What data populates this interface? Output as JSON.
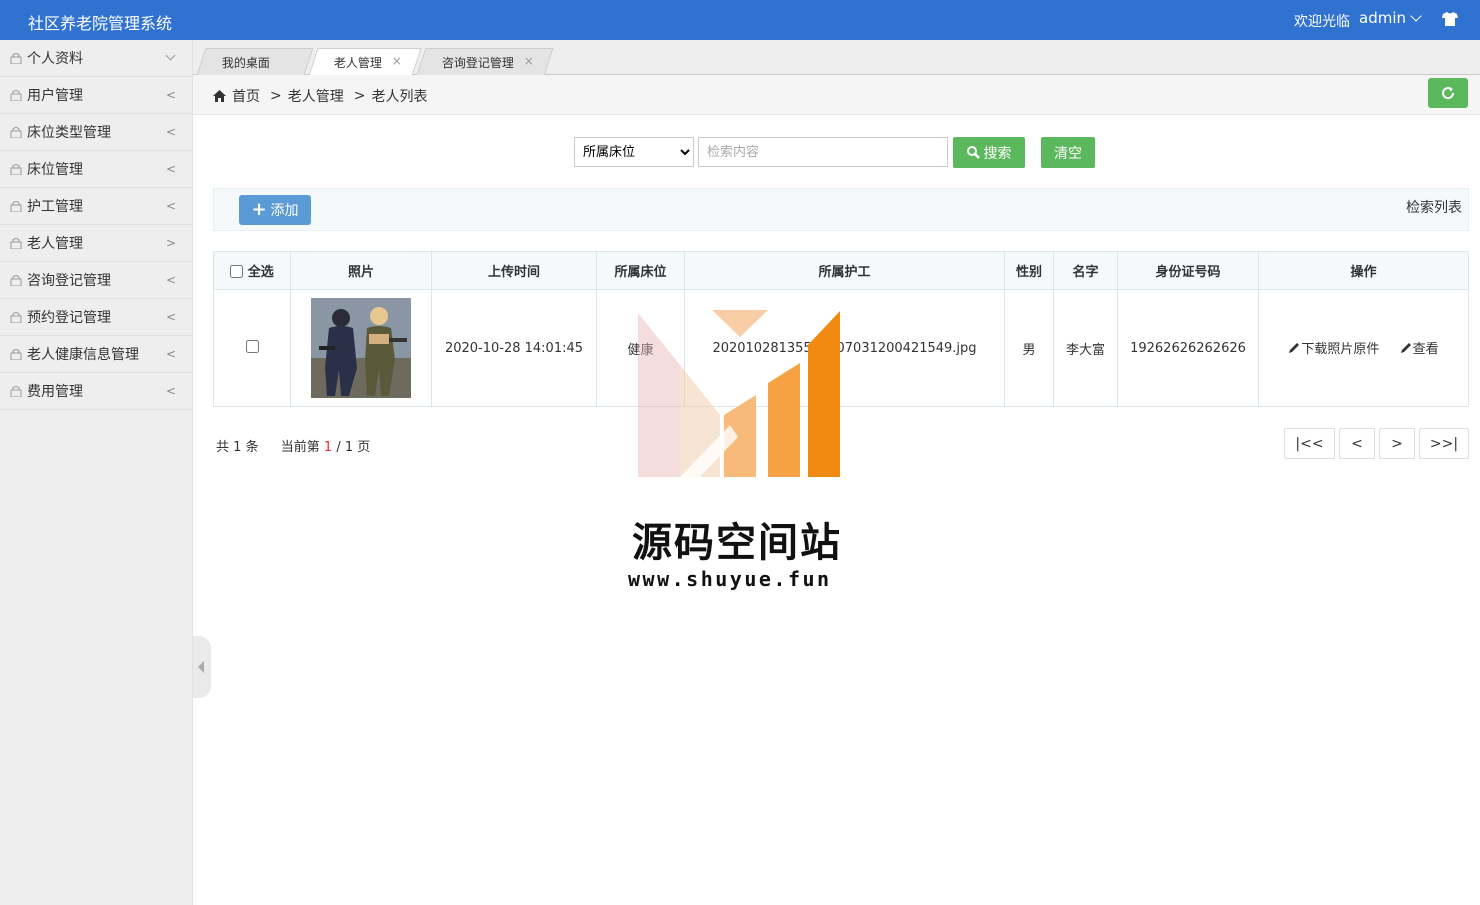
{
  "header": {
    "app_title": "社区养老院管理系统",
    "welcome": "欢迎光临",
    "username": "admin",
    "icons": [
      "chevron-down-icon",
      "shirt-icon"
    ],
    "color": "#3072cf"
  },
  "sidebar": {
    "items": [
      {
        "label": "个人资料",
        "arrow": "down"
      },
      {
        "label": "用户管理",
        "arrow": "<"
      },
      {
        "label": "床位类型管理",
        "arrow": "<"
      },
      {
        "label": "床位管理",
        "arrow": "<"
      },
      {
        "label": "护工管理",
        "arrow": "<"
      },
      {
        "label": "老人管理",
        "arrow": ">"
      },
      {
        "label": "咨询登记管理",
        "arrow": "<"
      },
      {
        "label": "预约登记管理",
        "arrow": "<"
      },
      {
        "label": "老人健康信息管理",
        "arrow": "<"
      },
      {
        "label": "费用管理",
        "arrow": "<"
      }
    ]
  },
  "tabs": [
    {
      "label": "我的桌面",
      "closable": false,
      "active": false
    },
    {
      "label": "老人管理",
      "closable": true,
      "active": true
    },
    {
      "label": "咨询登记管理",
      "closable": true,
      "active": false
    }
  ],
  "tab_close_glyph": "×",
  "breadcrumb": {
    "home": "首页",
    "sep": ">",
    "level1": "老人管理",
    "level2": "老人列表"
  },
  "search": {
    "select_value": "所属床位",
    "placeholder": "检索内容",
    "search_label": "搜索",
    "clear_label": "清空"
  },
  "toolbar": {
    "add_label": "添加",
    "list_title": "检索列表"
  },
  "table": {
    "headers": [
      "全选",
      "照片",
      "上传时间",
      "所属床位",
      "所属护工",
      "性别",
      "名字",
      "身份证号码",
      "操作"
    ],
    "rows": [
      {
        "upload_time": "2020-10-28 14:01:45",
        "bed": "健康",
        "nurse": "20201028135503807031200421549.jpg",
        "gender": "男",
        "name": "李大富",
        "id_number": "19262626262626",
        "op_download": "下载照片原件",
        "op_view": "查看"
      }
    ]
  },
  "pagination": {
    "total_prefix": "共",
    "total": "1",
    "total_suffix": "条",
    "current_prefix": "当前第",
    "current": "1",
    "slash": "/",
    "pages": "1",
    "pages_suffix": "页",
    "first": "|<<",
    "prev": "<",
    "next": ">",
    "last": ">>|"
  },
  "watermark": {
    "title": "源码空间站",
    "url": "www.shuyue.fun"
  },
  "colors": {
    "green": "#5cb85c",
    "blue_button": "#5a9bd5",
    "page_current": "#e0302b"
  }
}
